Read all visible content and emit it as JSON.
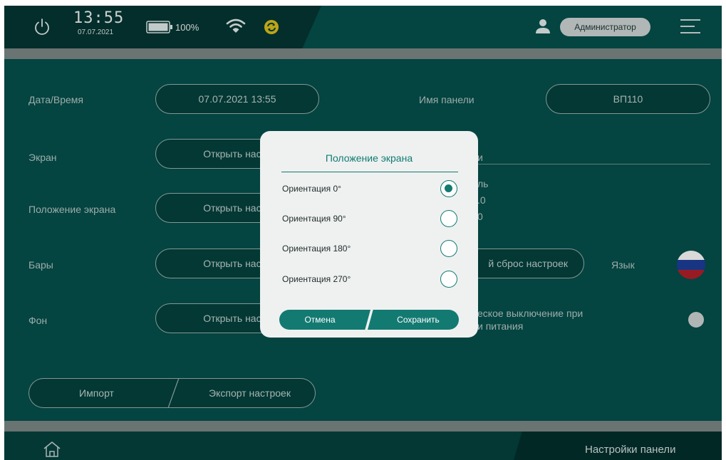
{
  "status": {
    "time": "13:55",
    "date": "07.07.2021",
    "battery": "100%"
  },
  "user": {
    "role": "Администратор"
  },
  "settings": {
    "datetime_label": "Дата/Время",
    "datetime_value": "07.07.2021 13:55",
    "panel_name_label": "Имя панели",
    "panel_name_value": "ВП110",
    "screen_label": "Экран",
    "screen_button": "Открыть настр",
    "screen_right_partial": "и",
    "orientation_label": "Положение экрана",
    "orientation_button": "Открыть настр",
    "model_partial_1": "ль",
    "model_partial_2": ".0",
    "model_partial_3": "0",
    "bars_label": "Бары",
    "bars_button": "Открыть настр",
    "reset_button": "й сброс настроек",
    "language_label": "Язык",
    "background_label": "Фон",
    "background_button": "Открыть настр",
    "auto_off_line1": "еское выключение при",
    "auto_off_line2": "и питания"
  },
  "actions": {
    "import": "Импорт",
    "export": "Экспорт настроек"
  },
  "bottom": {
    "title": "Настройки панели"
  },
  "dialog": {
    "title": "Положение экрана",
    "options": [
      {
        "label": "Ориентация 0°",
        "checked": true
      },
      {
        "label": "Ориентация 90°",
        "checked": false
      },
      {
        "label": "Ориентация 180°",
        "checked": false
      },
      {
        "label": "Ориентация 270°",
        "checked": false
      }
    ],
    "cancel": "Отмена",
    "save": "Сохранить"
  },
  "colors": {
    "background": "#05514d",
    "accent": "#137a72",
    "sync_icon": "#e0c21a"
  },
  "icons": [
    "power-icon",
    "battery-icon",
    "wifi-icon",
    "sync-icon",
    "user-icon",
    "menu-icon",
    "home-icon",
    "flag-ru-icon"
  ]
}
